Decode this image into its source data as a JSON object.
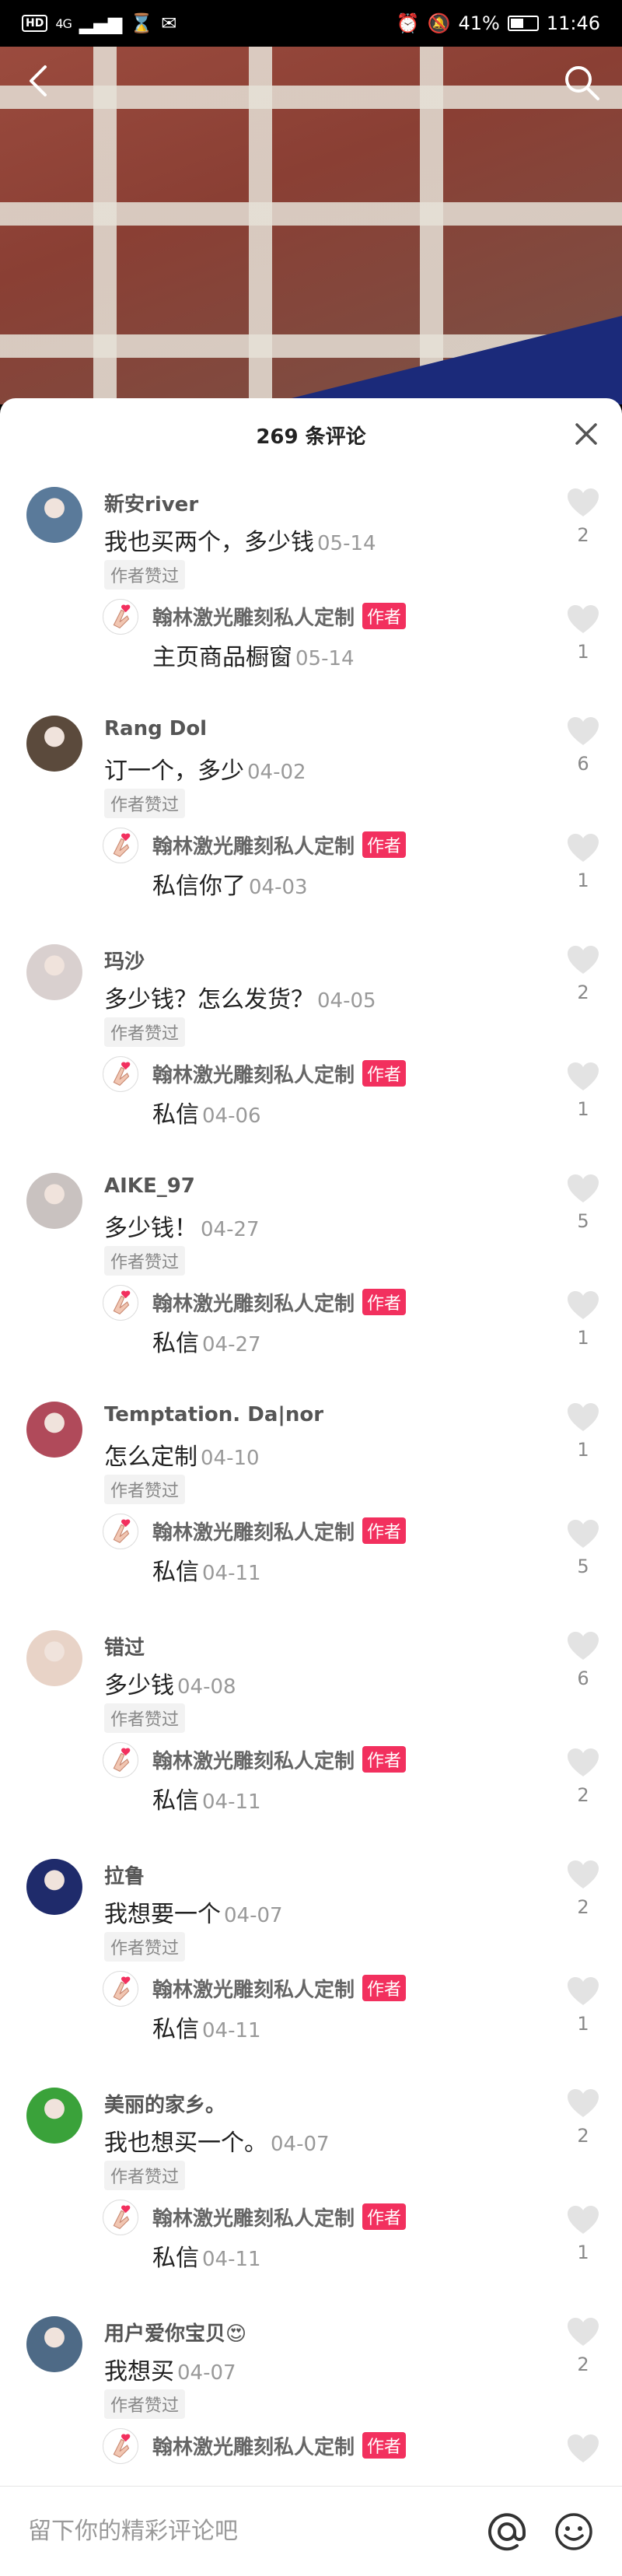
{
  "status_bar": {
    "hd": "HD",
    "signal": "4G",
    "battery": "41%",
    "time": "11:46"
  },
  "sheet": {
    "title": "269 条评论"
  },
  "comments": [
    {
      "name": "新安river",
      "text": "我也买两个，多少钱",
      "date": "05-14",
      "liked_by_author": "作者赞过",
      "likes": "2",
      "reply": {
        "name": "翰林激光雕刻私人定制",
        "badge": "作者",
        "text": "主页商品橱窗",
        "date": "05-14",
        "likes": "1"
      }
    },
    {
      "name": "Rang Dol",
      "text": "订一个，多少",
      "date": "04-02",
      "liked_by_author": "作者赞过",
      "likes": "6",
      "reply": {
        "name": "翰林激光雕刻私人定制",
        "badge": "作者",
        "text": "私信你了",
        "date": "04-03",
        "likes": "1"
      }
    },
    {
      "name": "玛沙",
      "text": "多少钱？怎么发货？",
      "date": "04-05",
      "liked_by_author": "作者赞过",
      "likes": "2",
      "reply": {
        "name": "翰林激光雕刻私人定制",
        "badge": "作者",
        "text": "私信",
        "date": "04-06",
        "likes": "1"
      }
    },
    {
      "name": "AIKE_97",
      "text": "多少钱！",
      "date": "04-27",
      "liked_by_author": "作者赞过",
      "likes": "5",
      "reply": {
        "name": "翰林激光雕刻私人定制",
        "badge": "作者",
        "text": "私信",
        "date": "04-27",
        "likes": "1"
      }
    },
    {
      "name": "Temptation. Da|nor",
      "text": "怎么定制",
      "date": "04-10",
      "liked_by_author": "作者赞过",
      "likes": "1",
      "reply": {
        "name": "翰林激光雕刻私人定制",
        "badge": "作者",
        "text": "私信",
        "date": "04-11",
        "likes": "5"
      }
    },
    {
      "name": "错过",
      "text": "多少钱",
      "date": "04-08",
      "liked_by_author": "作者赞过",
      "likes": "6",
      "reply": {
        "name": "翰林激光雕刻私人定制",
        "badge": "作者",
        "text": "私信",
        "date": "04-11",
        "likes": "2"
      }
    },
    {
      "name": "拉鲁",
      "text": "我想要一个",
      "date": "04-07",
      "liked_by_author": "作者赞过",
      "likes": "2",
      "reply": {
        "name": "翰林激光雕刻私人定制",
        "badge": "作者",
        "text": "私信",
        "date": "04-11",
        "likes": "1"
      }
    },
    {
      "name": "美丽的家乡。",
      "text": "我也想买一个。",
      "date": "04-07",
      "liked_by_author": "作者赞过",
      "likes": "2",
      "reply": {
        "name": "翰林激光雕刻私人定制",
        "badge": "作者",
        "text": "私信",
        "date": "04-11",
        "likes": "1"
      }
    },
    {
      "name": "用户爱你宝贝😍",
      "text": "我想买",
      "date": "04-07",
      "liked_by_author": "作者赞过",
      "likes": "2",
      "reply": {
        "name": "翰林激光雕刻私人定制",
        "badge": "作者",
        "text": "",
        "date": "",
        "likes": ""
      }
    }
  ],
  "footer": {
    "placeholder": "留下你的精彩评论吧"
  },
  "avatar_colors": [
    "#5a7a9a",
    "#5b4a3c",
    "#d9d0cf",
    "#c9c2c0",
    "#b04a5a",
    "#e8d3c7",
    "#1f2b6b",
    "#3aa23a",
    "#4e6a86"
  ],
  "icons": {
    "back": "chevron-left-icon",
    "search": "search-icon",
    "close": "close-icon",
    "like": "heart-icon",
    "mention": "at-icon",
    "emoji": "emoji-icon"
  }
}
